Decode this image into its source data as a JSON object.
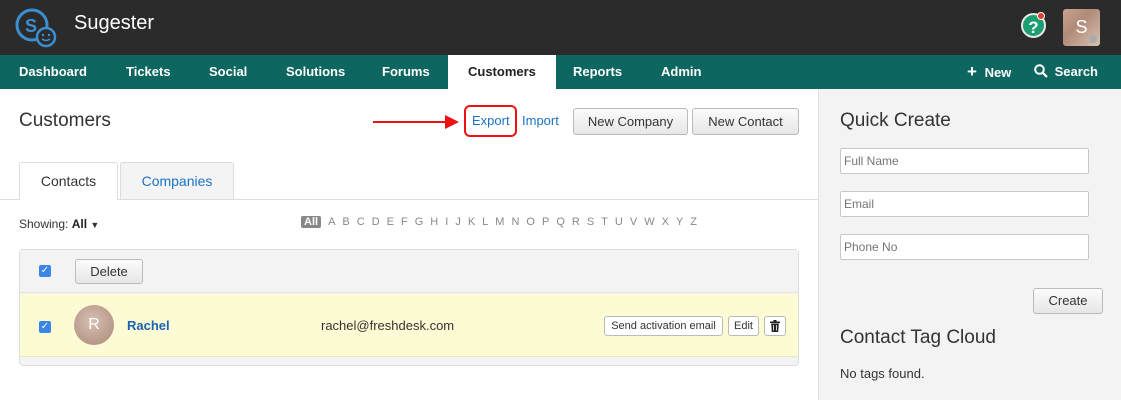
{
  "app": {
    "title": "Sugester",
    "avatar_initial": "S"
  },
  "nav": {
    "items": [
      "Dashboard",
      "Tickets",
      "Social",
      "Solutions",
      "Forums",
      "Customers",
      "Reports",
      "Admin"
    ],
    "active": "Customers",
    "new_label": "New",
    "search_label": "Search"
  },
  "main": {
    "title": "Customers",
    "export_label": "Export",
    "import_label": "Import",
    "new_company_label": "New Company",
    "new_contact_label": "New Contact",
    "tabs": [
      "Contacts",
      "Companies"
    ],
    "showing_label": "Showing:",
    "showing_value": "All",
    "letters": [
      "All",
      "A",
      "B",
      "C",
      "D",
      "E",
      "F",
      "G",
      "H",
      "I",
      "J",
      "K",
      "L",
      "M",
      "N",
      "O",
      "P",
      "Q",
      "R",
      "S",
      "T",
      "U",
      "V",
      "W",
      "X",
      "Y",
      "Z"
    ],
    "delete_label": "Delete",
    "contacts": [
      {
        "initial": "R",
        "name": "Rachel",
        "email": "rachel@freshdesk.com",
        "send_activation_label": "Send activation email",
        "edit_label": "Edit"
      }
    ]
  },
  "sidebar": {
    "quick_create_title": "Quick Create",
    "full_name_placeholder": "Full Name",
    "email_placeholder": "Email",
    "phone_placeholder": "Phone No",
    "create_label": "Create",
    "tag_cloud_title": "Contact Tag Cloud",
    "no_tags_text": "No tags found."
  },
  "colors": {
    "topbar": "#2b2b2b",
    "navbar": "#0e6660",
    "link": "#1a73c7",
    "highlight": "#e11111",
    "row_bg": "#fcfbd3"
  }
}
